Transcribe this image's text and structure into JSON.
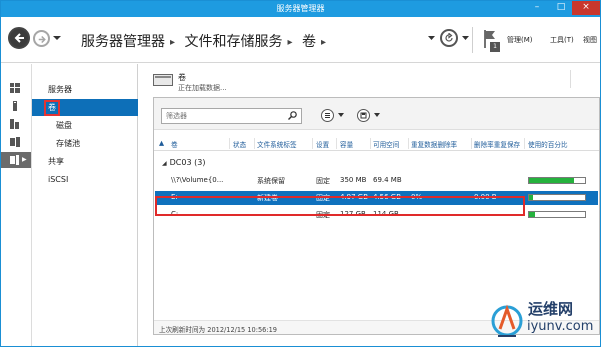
{
  "window": {
    "title": "服务器管理器",
    "controls": {
      "minimize": "–",
      "maximize": "□",
      "close": "×"
    }
  },
  "header": {
    "breadcrumb": [
      "服务器管理器",
      "文件和存储服务",
      "卷"
    ],
    "separator": "▸",
    "notification_count": "1",
    "menus": {
      "manage": "管理(M)",
      "tools": "工具(T)",
      "view": "视图"
    }
  },
  "rail": {
    "icons": [
      "dashboard-icon",
      "local-server-icon",
      "all-servers-icon",
      "file-services-icon",
      "file-storage-icon"
    ]
  },
  "nav": {
    "items": [
      {
        "label": "服务器",
        "level": 0
      },
      {
        "label": "卷",
        "level": 0,
        "selected": true
      },
      {
        "label": "磁盘",
        "level": 1
      },
      {
        "label": "存储池",
        "level": 1
      },
      {
        "label": "共享",
        "level": 0
      },
      {
        "label": "iSCSI",
        "level": 0
      }
    ]
  },
  "volumes": {
    "title": "卷",
    "status": "正在加载数据...",
    "filter_placeholder": "筛选器",
    "columns": [
      "卷",
      "状态",
      "文件系统标签",
      "设置",
      "容量",
      "可用空间",
      "重复数据删除率",
      "删除率重复保存",
      "使用的百分比"
    ],
    "group": {
      "name": "DC03",
      "count": "(3)"
    },
    "rows": [
      {
        "volume": "\\\\?\\Volume{0...",
        "status": "",
        "label": "系统保留",
        "provisioning": "固定",
        "capacity": "350 MB",
        "free": "69.4 MB",
        "dedup_rate": "",
        "dedup_savings": "",
        "used_pct": 80
      },
      {
        "volume": "E:",
        "status": "",
        "label": "新建卷",
        "provisioning": "固定",
        "capacity": "4.97 GB",
        "free": "4.56 GB",
        "dedup_rate": "0%",
        "dedup_savings": "0.00 B",
        "used_pct": 8
      },
      {
        "volume": "C:",
        "status": "",
        "label": "",
        "provisioning": "固定",
        "capacity": "127 GB",
        "free": "114 GB",
        "dedup_rate": "",
        "dedup_savings": "",
        "used_pct": 10
      }
    ],
    "last_refresh": "上次刷新时间为 2012/12/15 10:56:19"
  },
  "watermark": {
    "cn": "运维网",
    "en": "iyunv.com"
  },
  "colors": {
    "titlebar": "#1e9be0",
    "selection": "#0f71bd",
    "nav_selected": "#0d6fb8",
    "highlight": "#e02a2a",
    "usage_bar": "#25b23d"
  }
}
